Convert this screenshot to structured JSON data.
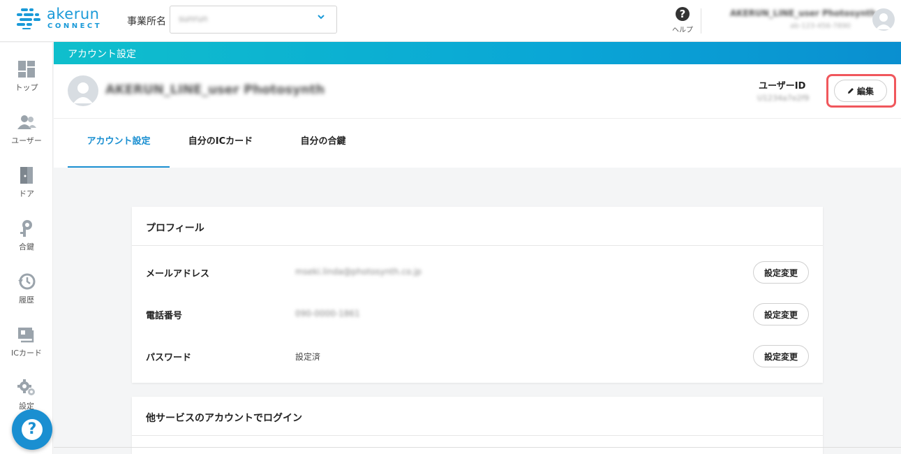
{
  "brand": {
    "name": "akerun",
    "sub": "CONNECT",
    "color": "#1a9ad8"
  },
  "header": {
    "office_label": "事業所名",
    "office_value": "sunrun",
    "help_label": "ヘルプ",
    "user_name": "AKERUN_LINE_user Photosynth",
    "user_sub": "ab-123-456-7890"
  },
  "sidebar": {
    "items": [
      {
        "label": "トップ",
        "icon": "dashboard-icon"
      },
      {
        "label": "ユーザー",
        "icon": "users-icon"
      },
      {
        "label": "ドア",
        "icon": "door-icon"
      },
      {
        "label": "合鍵",
        "icon": "key-icon"
      },
      {
        "label": "履歴",
        "icon": "history-icon"
      },
      {
        "label": "ICカード",
        "icon": "ic-card-icon"
      },
      {
        "label": "設定",
        "icon": "gear-icon"
      }
    ],
    "fab_glyph": "?"
  },
  "banner": {
    "title": "アカウント設定"
  },
  "profile": {
    "name": "AKERUN_LINE_user Photosynth",
    "user_id_label": "ユーザーID",
    "user_id_value": "U1234a7e2f9",
    "edit_label": "編集"
  },
  "tabs": [
    {
      "label": "アカウント設定",
      "active": true
    },
    {
      "label": "自分のICカード",
      "active": false
    },
    {
      "label": "自分の合鍵",
      "active": false
    }
  ],
  "profile_card": {
    "title": "プロフィール",
    "rows": [
      {
        "label": "メールアドレス",
        "value": "mseki.linda@photosynth.co.jp",
        "button": "設定変更"
      },
      {
        "label": "電話番号",
        "value": "090-0000-1861",
        "button": "設定変更"
      },
      {
        "label": "パスワード",
        "value": "設定済",
        "button": "設定変更"
      }
    ]
  },
  "login_card": {
    "title": "他サービスのアカウントでログイン"
  }
}
